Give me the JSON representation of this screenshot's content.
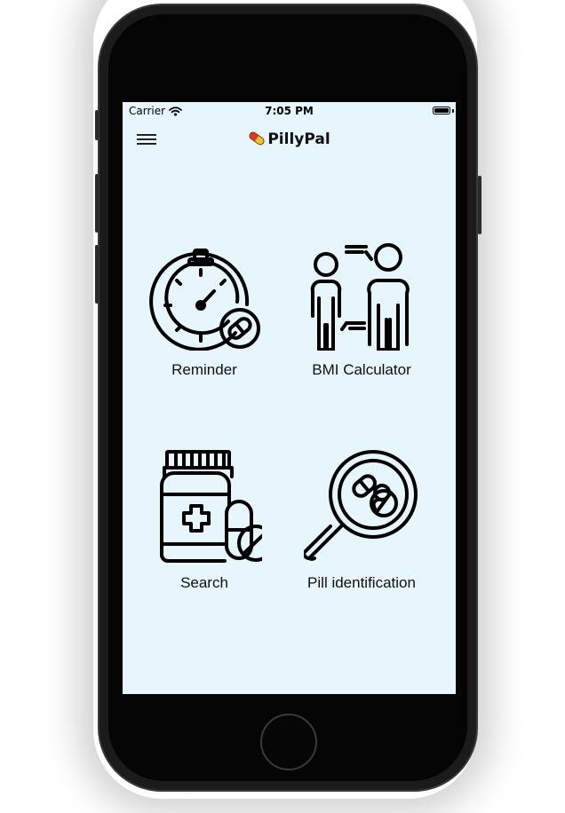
{
  "status_bar": {
    "carrier": "Carrier",
    "time": "7:05 PM",
    "wifi_icon": "wifi-icon",
    "battery_icon": "battery-icon"
  },
  "nav": {
    "menu_icon": "hamburger-menu-icon",
    "logo_icon": "pill-icon",
    "title": "PillyPal"
  },
  "tiles": [
    {
      "label": "Reminder",
      "icon": "stopwatch-pill-icon"
    },
    {
      "label": "BMI Calculator",
      "icon": "body-height-icon"
    },
    {
      "label": "Search",
      "icon": "medicine-bottle-icon"
    },
    {
      "label": "Pill identification",
      "icon": "magnifier-pills-icon"
    }
  ],
  "colors": {
    "screen_background": "#e6f6fc",
    "phone_body": "#1b1b1b",
    "icon_stroke": "#000000",
    "pill_red": "#d83a2c",
    "pill_yellow": "#f2c12e"
  }
}
